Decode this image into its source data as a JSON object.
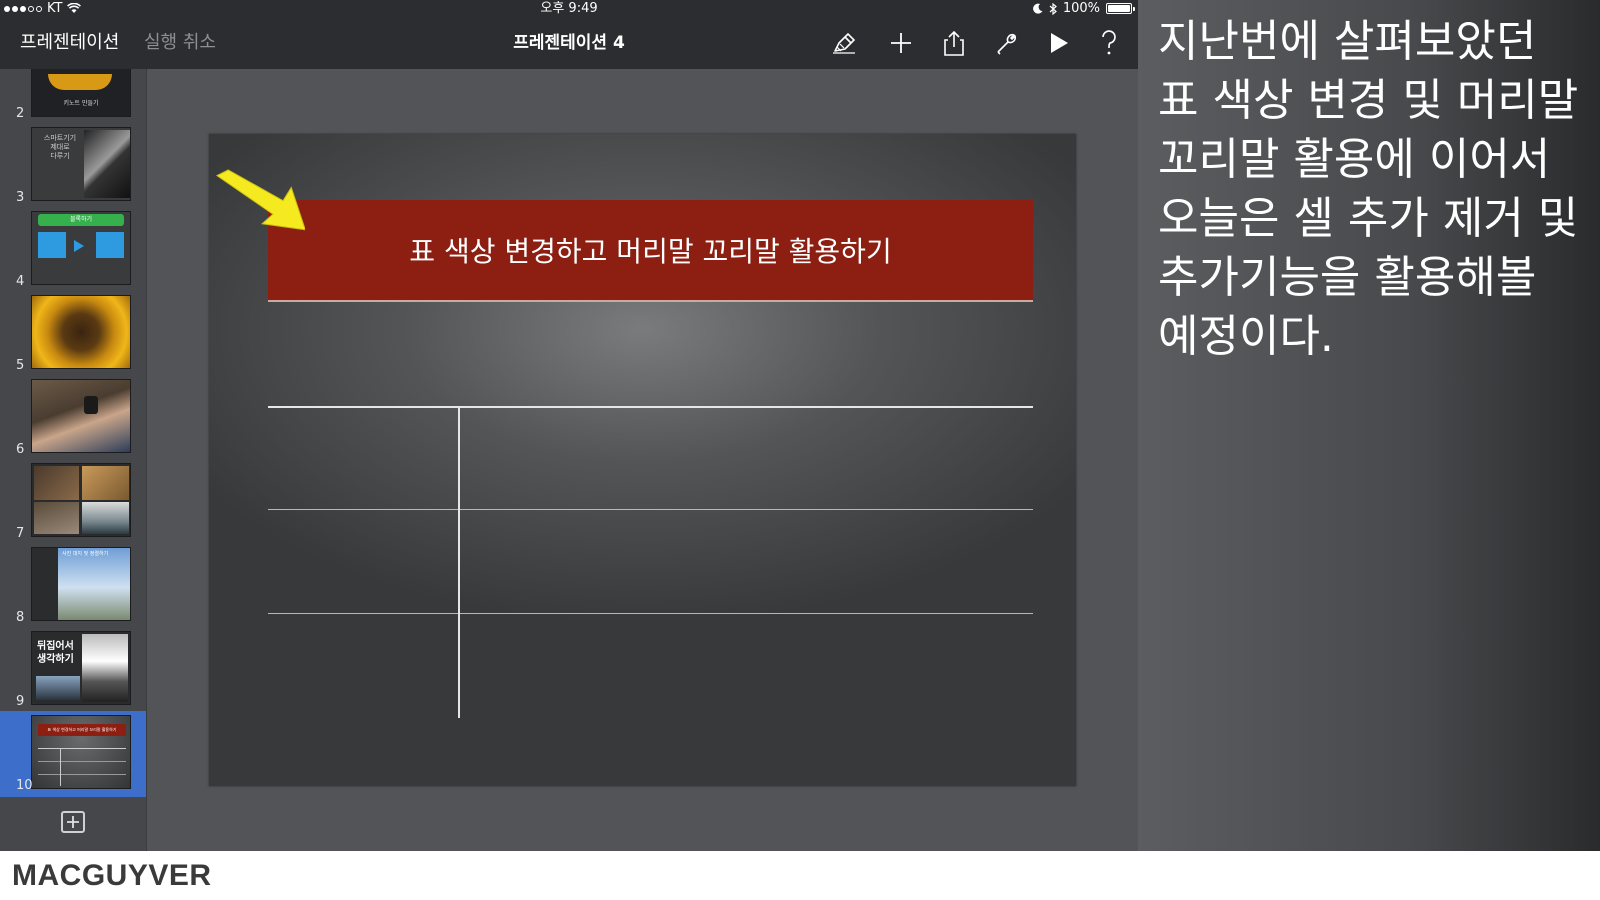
{
  "status_bar": {
    "carrier": "KT",
    "time": "오후 9:49",
    "battery": "100%",
    "battery_level": 1.0
  },
  "nav": {
    "back_label": "프레젠테이션",
    "undo_label": "실행 취소",
    "document_title": "프레젠테이션 4",
    "tools": [
      "brush-icon",
      "plus-icon",
      "share-icon",
      "wrench-icon",
      "play-icon",
      "help-icon"
    ]
  },
  "sidebar": {
    "slides": [
      {
        "number": "2",
        "kind": "sunflower-title",
        "text": "키노트 만들기"
      },
      {
        "number": "3",
        "kind": "text-photo",
        "lines": [
          "스마트기기",
          "제대로",
          "다루기"
        ]
      },
      {
        "number": "4",
        "kind": "diagram",
        "text": "블록하기"
      },
      {
        "number": "5",
        "kind": "sunflower"
      },
      {
        "number": "6",
        "kind": "watch-photo"
      },
      {
        "number": "7",
        "kind": "photo-grid"
      },
      {
        "number": "8",
        "kind": "sky-photo",
        "text": "사진 대지 및 정렬하기"
      },
      {
        "number": "9",
        "kind": "text-photo-dark",
        "lines": [
          "뒤집어서",
          "생각하기"
        ]
      },
      {
        "number": "10",
        "kind": "current-table",
        "selected": true
      }
    ]
  },
  "slide": {
    "title": "표 색상 변경하고 머리말 꼬리말 활용하기",
    "title_bg": "#8c1f12",
    "arrow_color": "#f5ea1f",
    "table_rows": 3,
    "table_cols": 2
  },
  "caption": "지난번에 살펴보았던 표 색상 변경 및 머리말 꼬리말 활용에 이어서 오늘은 셀 추가 제거 및 추가기능을 활용해볼 예정이다.",
  "watermark": "MACGUYVER"
}
